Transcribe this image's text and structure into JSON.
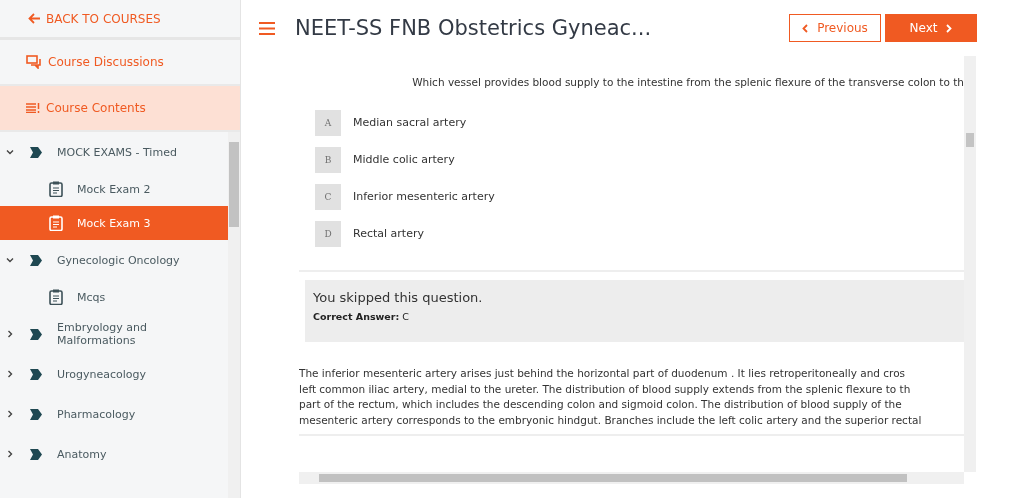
{
  "sidebar": {
    "back": "BACK TO COURSES",
    "links": [
      {
        "label": "Course Discussions",
        "kind": "discussions",
        "selected": false
      },
      {
        "label": "Course Contents",
        "kind": "contents",
        "selected": true
      }
    ],
    "tree": [
      {
        "label": "MOCK EXAMS - Timed",
        "expanded": true,
        "children": [
          {
            "label": "Mock Exam 2",
            "selected": false
          },
          {
            "label": "Mock Exam 3",
            "selected": true
          }
        ]
      },
      {
        "label": "Gynecologic Oncology",
        "expanded": true,
        "children": [
          {
            "label": "Mcqs",
            "selected": false
          }
        ]
      },
      {
        "label": "Embryology and Malformations",
        "expanded": false
      },
      {
        "label": "Urogyneacology",
        "expanded": false
      },
      {
        "label": "Pharmacology",
        "expanded": false
      },
      {
        "label": "Anatomy",
        "expanded": false
      }
    ]
  },
  "header": {
    "title": "NEET-SS FNB Obstetrics Gyneac...",
    "previous": "Previous",
    "next": "Next"
  },
  "question": {
    "text": "Which vessel provides blood supply to the intestine from the splenic flexure of the transverse colon to th",
    "options": [
      {
        "letter": "A",
        "label": "Median sacral artery"
      },
      {
        "letter": "B",
        "label": "Middle colic artery"
      },
      {
        "letter": "C",
        "label": "Inferior mesenteric artery"
      },
      {
        "letter": "D",
        "label": "Rectal artery"
      }
    ]
  },
  "result": {
    "message": "You skipped this question.",
    "answer_label": "Correct Answer:",
    "answer": "C"
  },
  "explanation": [
    "The inferior mesenteric artery arises just behind the horizontal part of duodenum . It lies retroperitoneally and cros",
    "left common iliac artery, medial to the ureter. The distribution of blood supply extends from the splenic flexure to th",
    "part of the rectum, which includes the descending colon and sigmoid colon. The distribution of blood supply of the",
    "mesenteric artery corresponds to the embryonic hindgut. Branches include the left colic artery and the superior rectal"
  ]
}
